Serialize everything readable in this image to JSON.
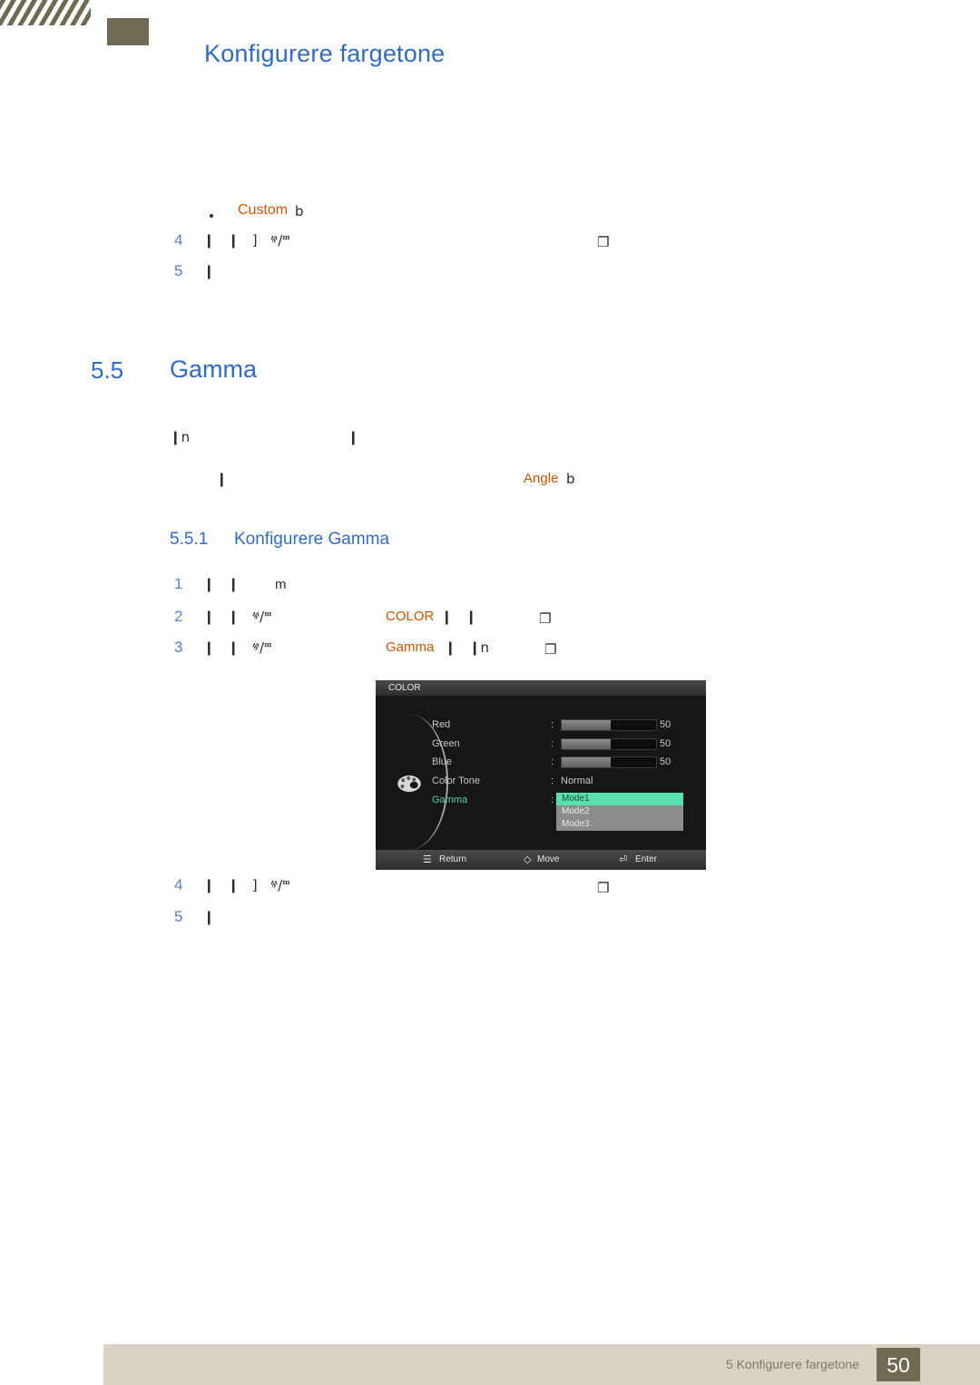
{
  "header": {
    "title": "Konfigurere fargetone"
  },
  "custom_bullet": {
    "label": "Custom",
    "suffix": "b"
  },
  "steps_top": [
    {
      "num": "4",
      "glyphs": "❙   ❙   ]   ⱍ/ⱎ",
      "end_glyph": "❐"
    },
    {
      "num": "5",
      "glyphs": "❙"
    }
  ],
  "section": {
    "number": "5.5",
    "title": "Gamma"
  },
  "intro": {
    "line1_a": "❙n",
    "line1_b": "❙",
    "line2_a": "❙",
    "line2_link": "Angle",
    "line2_suffix": "b"
  },
  "subsection": {
    "number": "5.5.1",
    "title": "Konfigurere Gamma"
  },
  "steps_bottom": [
    {
      "num": "1",
      "glyphs": "❙   ❙",
      "extra": "m"
    },
    {
      "num": "2",
      "glyphs": "❙   ❙   ⱍ/ⱎ",
      "target": "COLOR",
      "after": "❙   ❙",
      "end_glyph": "❐"
    },
    {
      "num": "3",
      "glyphs": "❙   ❙   ⱍ/ⱎ",
      "target": "Gamma",
      "after": "❙   ❙n",
      "end_glyph": "❐"
    },
    {
      "num": "4",
      "glyphs": "❙   ❙   ]   ⱍ/ⱎ",
      "end_glyph": "❐"
    },
    {
      "num": "5",
      "glyphs": "❙"
    }
  ],
  "osd": {
    "title": "COLOR",
    "rows": [
      {
        "label": "Red",
        "colon": ":",
        "value": "50",
        "fill_pct": 52
      },
      {
        "label": "Green",
        "colon": ":",
        "value": "50",
        "fill_pct": 52
      },
      {
        "label": "Blue",
        "colon": ":",
        "value": "50",
        "fill_pct": 52
      }
    ],
    "color_tone": {
      "label": "Color Tone",
      "colon": ":",
      "value": "Normal"
    },
    "gamma": {
      "label": "Gamma",
      "colon": ":"
    },
    "gamma_options": [
      {
        "label": "Mode1",
        "selected": true
      },
      {
        "label": "Mode2",
        "selected": false
      },
      {
        "label": "Mode3",
        "selected": false
      }
    ],
    "footer": [
      {
        "icon": "☰",
        "label": "Return"
      },
      {
        "icon": "◇",
        "label": "Move"
      },
      {
        "icon": "⏎",
        "label": "Enter"
      }
    ]
  },
  "footer": {
    "text": "5 Konfigurere fargetone",
    "page": "50"
  }
}
